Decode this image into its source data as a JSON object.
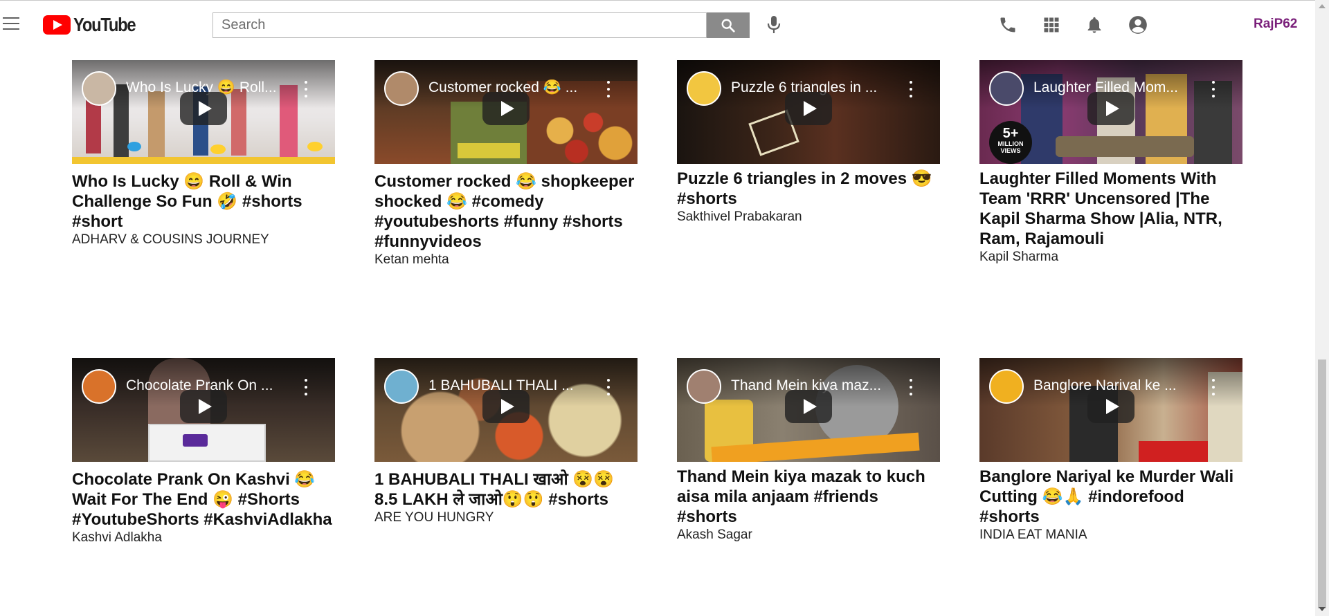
{
  "header": {
    "logo_text": "YouTube",
    "search_placeholder": "Search",
    "user_name": "RajP62"
  },
  "videos": [
    {
      "thumb_title": "Who Is Lucky 😄 Roll...",
      "title": "Who Is Lucky 😄 Roll & Win Challenge So Fun 🤣 #shorts #short",
      "channel": "ADHARV & COUSINS JOURNEY"
    },
    {
      "thumb_title": "Customer rocked 😂 ...",
      "title": "Customer rocked 😂 shopkeeper shocked 😂 #comedy #youtubeshorts #funny #shorts #funnyvideos",
      "channel": "Ketan mehta"
    },
    {
      "thumb_title": "Puzzle 6 triangles in ...",
      "title": "Puzzle 6 triangles in 2 moves 😎 #shorts",
      "channel": "Sakthivel Prabakaran"
    },
    {
      "thumb_title": "Laughter Filled Mom...",
      "title": "Laughter Filled Moments With Team 'RRR' Uncensored |The Kapil Sharma Show |Alia, NTR, Ram, Rajamouli",
      "channel": "Kapil Sharma",
      "badge_big": "5+",
      "badge_small": "MILLION VIEWS"
    },
    {
      "thumb_title": "Chocolate Prank On ...",
      "title": "Chocolate Prank On Kashvi 😂 Wait For The End 😜 #Shorts #YoutubeShorts #KashviAdlakha",
      "channel": "Kashvi Adlakha"
    },
    {
      "thumb_title": "1 BAHUBALI THALI ...",
      "title": "1 BAHUBALI THALI खाओ 😵😵 8.5 LAKH ले जाओ😲😲 #shorts",
      "channel": "ARE YOU HUNGRY"
    },
    {
      "thumb_title": "Thand Mein kiya maz...",
      "title": "Thand Mein kiya mazak to kuch aisa mila anjaam #friends #shorts",
      "channel": "Akash Sagar"
    },
    {
      "thumb_title": "Banglore Narival ke ...",
      "title": "Banglore Nariyal ke Murder Wali Cutting 😂🙏 #indorefood #shorts",
      "channel": "INDIA EAT MANIA"
    }
  ]
}
